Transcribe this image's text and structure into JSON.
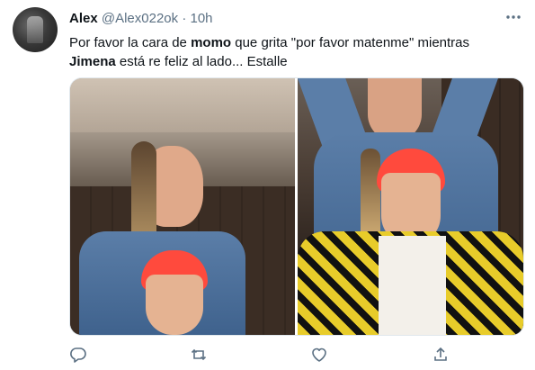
{
  "tweet": {
    "author_name": "Alex",
    "handle": "@Alex022ok",
    "separator": "·",
    "time": "10h",
    "text_1": "Por favor la cara de ",
    "text_bold_1": "momo",
    "text_2": " que grita \"por favor matenme\" mientras ",
    "text_bold_2": "Jimena",
    "text_3": " está re feliz al lado... Estalle"
  },
  "icons": {
    "avatar": "avatar",
    "more": "more-icon",
    "reply": "reply-icon",
    "retweet": "retweet-icon",
    "like": "like-icon",
    "share": "share-icon"
  },
  "colors": {
    "text": "#0f1419",
    "secondary": "#5b7083",
    "hair_pink": "#ff4a3d",
    "plaid_yellow": "#e8cc2a"
  }
}
